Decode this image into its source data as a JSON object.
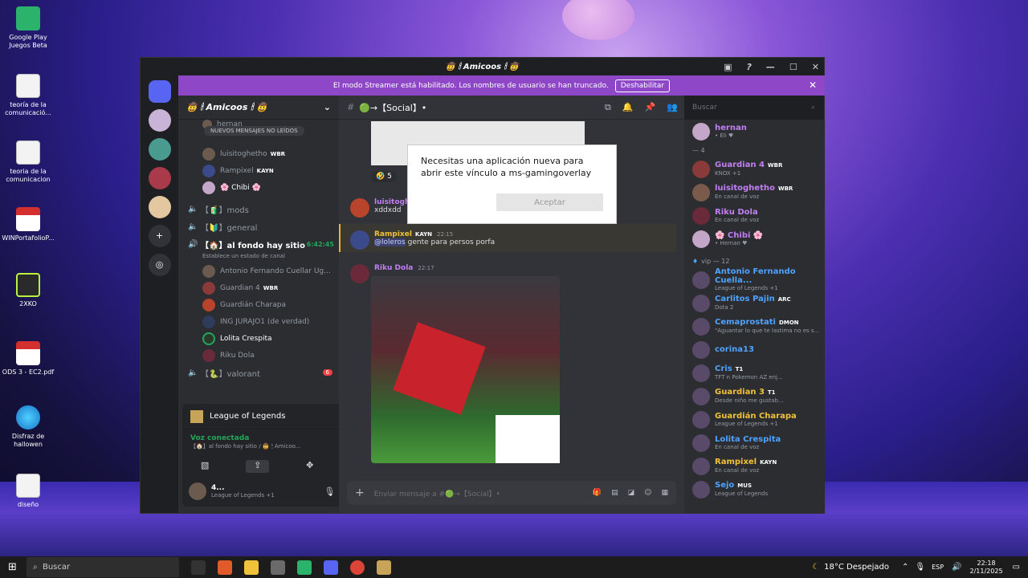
{
  "desktop": {
    "icons": [
      "Google Play Juegos Beta",
      "teoría de la comunicació...",
      "teoria de la comunicacion",
      "WINPortafolioP...",
      "2XKO",
      "ODS 3 - EC2.pdf",
      "Disfraz de hallowen",
      "diseño"
    ]
  },
  "window": {
    "title": "🤠 🕯 Amicoos 🕯 🤠"
  },
  "banner": {
    "text": "El modo Streamer está habilitado. Los nombres de usuario se han truncado.",
    "button": "Deshabilitar"
  },
  "guild": {
    "name": "🤠 🕯 Amicoos 🕯 🤠"
  },
  "channels": {
    "new_messages": "NUEVOS MENSAJES NO LEÍDOS",
    "top_members": [
      {
        "name": "hernan"
      },
      {
        "name": "luisitoghetho",
        "tag": "WBR"
      },
      {
        "name": "Rampixel",
        "tag": "KAYN"
      },
      {
        "name": "🌸 Chibi 🌸"
      }
    ],
    "voice": [
      {
        "name": "【🧃】mods"
      },
      {
        "name": "【🔰】general"
      },
      {
        "name": "【🏠】al fondo hay sitio",
        "time": "6:42:45",
        "status": "Establece un estado de canal"
      }
    ],
    "voice_members": [
      {
        "name": "Antonio Fernando Cuellar Ug..."
      },
      {
        "name": "Guardian 4",
        "tag": "WBR"
      },
      {
        "name": "Guardián Charapa"
      },
      {
        "name": "ING JURAJO1 (de verdad)"
      },
      {
        "name": "Lolita Crespita"
      },
      {
        "name": "Riku Dola"
      }
    ],
    "valorant": {
      "name": "【🐍】valorant",
      "badge": "6"
    }
  },
  "panel": {
    "game": "League of Legends",
    "voice_status": "Voz conectada",
    "voice_path": "【🏠】al fondo hay sitio / 🤠 🕯 Amicoo...",
    "user": "4...",
    "user_status": "League of Legends +1"
  },
  "chat": {
    "channel": "🟢→【Social】•",
    "search_placeholder": "Buscar",
    "reaction_count": "5",
    "msg1_author": "luisitogh",
    "msg1_text": "xddxdd",
    "msg2_author": "Rampixel",
    "msg2_tag": "KAYN",
    "msg2_time": "22:15",
    "msg2_mention": "@loleros",
    "msg2_text": "gente para persos porfa",
    "msg3_author": "Riku Dola",
    "msg3_time": "22:17",
    "composer_placeholder": "Enviar mensaje a #🟢→【Social】•"
  },
  "members": {
    "top": [
      {
        "name": "hernan",
        "status": "• Eli ♥",
        "color": "#c27ff4"
      },
      {
        "cat": "— 4"
      },
      {
        "name": "Guardian 4",
        "tag": "WBR",
        "status": "KNOX +1",
        "color": "#c27ff4"
      },
      {
        "name": "luisitoghetho",
        "tag": "WBR",
        "status": "En canal de voz",
        "color": "#c27ff4"
      },
      {
        "name": "Riku Dola",
        "status": "En canal de voz",
        "color": "#c27ff4"
      },
      {
        "name": "🌸 Chibi 🌸",
        "status": "• Hernan ♥",
        "color": "#c27ff4"
      }
    ],
    "vip_label": "vip — 12",
    "vip": [
      {
        "name": "Antonio Fernando Cuella...",
        "status": "League of Legends +1",
        "color": "#4fa3ff"
      },
      {
        "name": "Carlitos Pajin",
        "tag": "ARC",
        "status": "Dota 2",
        "color": "#4fa3ff"
      },
      {
        "name": "Cemaprostati",
        "tag": "DMON",
        "status": "\"Aguantar lo que te lastima no es s...",
        "color": "#4fa3ff"
      },
      {
        "name": "corina13",
        "status": "",
        "color": "#4fa3ff"
      },
      {
        "name": "Cris",
        "tag": "T1",
        "status": "TFT n Pokemon AZ enj...",
        "color": "#4fa3ff"
      },
      {
        "name": "Guardian 3",
        "tag": "T1",
        "status": "Desde niño me gustab...",
        "color": "#f0c23a"
      },
      {
        "name": "Guardián Charapa",
        "status": "League of Legends +1",
        "color": "#f0c23a"
      },
      {
        "name": "Lolita Crespita",
        "status": "En canal de voz",
        "color": "#4fa3ff"
      },
      {
        "name": "Rampixel",
        "tag": "KAYN",
        "status": "En canal de voz",
        "color": "#f0c23a"
      },
      {
        "name": "Sejo",
        "tag": "MUS",
        "status": "League of Legends",
        "color": "#4fa3ff"
      }
    ]
  },
  "dialog": {
    "text": "Necesitas una aplicación nueva para abrir este vínculo a ms-gamingoverlay",
    "button": "Aceptar"
  },
  "taskbar": {
    "search": "Buscar",
    "weather": "18°C Despejado",
    "lang": "ESP",
    "time": "22:18",
    "date": "2/11/2025"
  }
}
